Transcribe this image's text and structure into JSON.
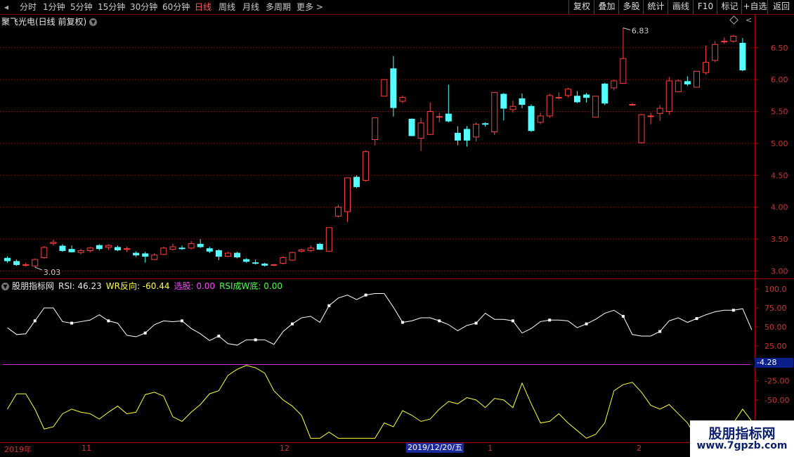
{
  "toolbar": {
    "periods": [
      "分时",
      "1分钟",
      "5分钟",
      "15分钟",
      "30分钟",
      "60分钟",
      "日线",
      "周线",
      "月线",
      "多周期",
      "更多"
    ],
    "active_period": "日线",
    "more_chevron": ">",
    "right_buttons": [
      "复权",
      "叠加",
      "多股",
      "统计",
      "画线",
      "F10",
      "标记",
      "+自选",
      "返回"
    ]
  },
  "main_chart": {
    "title": "聚飞光电(日线 前复权)",
    "dropdown_icon": "chevron-down-icon",
    "max_label": "6.83",
    "min_label": "3.03",
    "y_ticks": [
      "6.50",
      "6.00",
      "5.50",
      "5.00",
      "4.50",
      "4.00",
      "3.50",
      "3.00"
    ]
  },
  "indicator": {
    "name": "股朋指标网",
    "rsi": "RSI: 46.23",
    "wr": "WR反向: -60.44",
    "xuangu": "选股: 0.00",
    "rsiw": "RSI成W底: 0.00",
    "y_ticks": [
      "100.0",
      "75.00",
      "50.00",
      "25.00",
      "-25.00",
      "-50.00"
    ],
    "cursor_value": "-4.28"
  },
  "x_axis": {
    "labels": [
      "2019年",
      "11",
      "12",
      "1",
      "2"
    ],
    "highlight_date": "2019/12/20/五"
  },
  "watermark": {
    "line1": "股朋指标网",
    "line2": "www.7gpzb.com"
  },
  "colors": {
    "up": "#ff4040",
    "down": "#54ffff",
    "rsi": "#ffffff",
    "wr": "#ffff33",
    "zero_line": "#cc33cc"
  },
  "chart_data": {
    "type": "candlestick",
    "price_axis": {
      "min": 2.95,
      "max": 6.85
    },
    "candles": [
      [
        3.2,
        3.16,
        3.23,
        3.13
      ],
      [
        3.15,
        3.1,
        3.18,
        3.08
      ],
      [
        3.09,
        3.1,
        3.13,
        3.07
      ],
      [
        3.08,
        3.18,
        3.2,
        3.06
      ],
      [
        3.21,
        3.37,
        3.39,
        3.19
      ],
      [
        3.43,
        3.45,
        3.49,
        3.4
      ],
      [
        3.39,
        3.32,
        3.42,
        3.3
      ],
      [
        3.34,
        3.3,
        3.4,
        3.29
      ],
      [
        3.29,
        3.32,
        3.35,
        3.26
      ],
      [
        3.32,
        3.36,
        3.38,
        3.29
      ],
      [
        3.4,
        3.35,
        3.42,
        3.32
      ],
      [
        3.37,
        3.4,
        3.42,
        3.33
      ],
      [
        3.37,
        3.33,
        3.4,
        3.31
      ],
      [
        3.34,
        3.35,
        3.38,
        3.3
      ],
      [
        3.28,
        3.25,
        3.31,
        3.22
      ],
      [
        3.27,
        3.23,
        3.3,
        3.13
      ],
      [
        3.18,
        3.25,
        3.28,
        3.18
      ],
      [
        3.26,
        3.36,
        3.38,
        3.25
      ],
      [
        3.34,
        3.38,
        3.43,
        3.32
      ],
      [
        3.36,
        3.35,
        3.4,
        3.33
      ],
      [
        3.36,
        3.43,
        3.47,
        3.34
      ],
      [
        3.42,
        3.38,
        3.5,
        3.36
      ],
      [
        3.35,
        3.31,
        3.38,
        3.28
      ],
      [
        3.32,
        3.23,
        3.34,
        3.17
      ],
      [
        3.23,
        3.28,
        3.3,
        3.22
      ],
      [
        3.28,
        3.22,
        3.3,
        3.2
      ],
      [
        3.18,
        3.15,
        3.2,
        3.13
      ],
      [
        3.13,
        3.12,
        3.18,
        3.1
      ],
      [
        3.11,
        3.09,
        3.13,
        3.07
      ],
      [
        3.09,
        3.1,
        3.11,
        3.08
      ],
      [
        3.12,
        3.21,
        3.23,
        3.1
      ],
      [
        3.17,
        3.29,
        3.3,
        3.16
      ],
      [
        3.31,
        3.33,
        3.35,
        3.29
      ],
      [
        3.32,
        3.36,
        3.4,
        3.3
      ],
      [
        3.42,
        3.34,
        3.44,
        3.33
      ],
      [
        3.31,
        3.68,
        3.68,
        3.3
      ],
      [
        3.86,
        4.0,
        4.04,
        3.84
      ],
      [
        3.93,
        4.46,
        4.46,
        3.77
      ],
      [
        4.47,
        4.32,
        4.5,
        4.3
      ],
      [
        4.42,
        4.87,
        4.89,
        4.4
      ],
      [
        5.06,
        5.4,
        5.4,
        4.97
      ],
      [
        5.74,
        6.0,
        6.0,
        5.74
      ],
      [
        6.17,
        5.56,
        6.37,
        5.42
      ],
      [
        5.66,
        5.72,
        5.75,
        5.63
      ],
      [
        5.38,
        5.12,
        5.39,
        5.12
      ],
      [
        5.08,
        5.32,
        5.4,
        4.88
      ],
      [
        5.14,
        5.5,
        5.64,
        5.13
      ],
      [
        5.41,
        5.42,
        5.48,
        5.33
      ],
      [
        5.46,
        5.35,
        5.92,
        5.33
      ],
      [
        5.16,
        5.05,
        5.27,
        4.97
      ],
      [
        5.22,
        5.05,
        5.27,
        4.95
      ],
      [
        5.1,
        5.3,
        5.33,
        5.03
      ],
      [
        5.31,
        5.3,
        5.33,
        5.26
      ],
      [
        5.18,
        5.8,
        5.8,
        5.13
      ],
      [
        5.77,
        5.55,
        5.79,
        5.36
      ],
      [
        5.53,
        5.58,
        5.67,
        5.48
      ],
      [
        5.7,
        5.61,
        5.78,
        5.55
      ],
      [
        5.58,
        5.2,
        5.61,
        5.18
      ],
      [
        5.33,
        5.43,
        5.48,
        5.3
      ],
      [
        5.43,
        5.75,
        5.78,
        5.4
      ],
      [
        5.71,
        5.72,
        5.8,
        5.69
      ],
      [
        5.75,
        5.85,
        5.87,
        5.72
      ],
      [
        5.74,
        5.65,
        5.82,
        5.63
      ],
      [
        5.76,
        5.72,
        5.79,
        5.64
      ],
      [
        5.41,
        5.74,
        5.74,
        5.42
      ],
      [
        5.93,
        5.63,
        5.95,
        5.6
      ],
      [
        5.87,
        5.98,
        6.0,
        5.83
      ],
      [
        5.94,
        6.33,
        6.81,
        6.02
      ],
      [
        5.6,
        5.61,
        5.63,
        5.59
      ],
      [
        5.01,
        5.45,
        5.46,
        5.0
      ],
      [
        5.42,
        5.43,
        5.48,
        5.3
      ],
      [
        5.47,
        5.55,
        5.6,
        5.35
      ],
      [
        5.5,
        5.98,
        6.04,
        5.45
      ],
      [
        5.81,
        5.98,
        6.0,
        5.8
      ],
      [
        5.97,
        5.93,
        6.05,
        5.9
      ],
      [
        5.88,
        6.13,
        6.13,
        5.88
      ],
      [
        6.11,
        6.27,
        6.53,
        6.08
      ],
      [
        6.3,
        6.55,
        6.6,
        6.27
      ],
      [
        6.6,
        6.6,
        6.66,
        6.56
      ],
      [
        6.6,
        6.68,
        6.7,
        6.58
      ],
      [
        6.57,
        6.15,
        6.65,
        6.13
      ]
    ],
    "rsi": [
      49,
      40,
      41,
      58,
      75,
      75,
      57,
      55,
      57,
      59,
      66,
      58,
      55,
      39,
      37,
      42,
      53,
      58,
      57,
      58,
      48,
      41,
      32,
      38,
      28,
      26,
      33,
      33,
      33,
      27,
      44,
      54,
      62,
      64,
      56,
      78,
      88,
      92,
      86,
      92,
      94,
      94,
      76,
      56,
      58,
      62,
      62,
      58,
      53,
      45,
      52,
      55,
      68,
      60,
      60,
      58,
      42,
      48,
      57,
      59,
      59,
      58,
      49,
      54,
      60,
      68,
      72,
      64,
      40,
      38,
      38,
      44,
      58,
      62,
      56,
      61,
      66,
      70,
      72,
      72,
      74,
      46
    ],
    "wr": [
      -62,
      -42,
      -42,
      -62,
      -88,
      -85,
      -68,
      -62,
      -66,
      -68,
      -75,
      -66,
      -58,
      -68,
      -66,
      -43,
      -40,
      -45,
      -72,
      -78,
      -66,
      -56,
      -42,
      -38,
      -18,
      -10,
      -5,
      -8,
      -15,
      -38,
      -50,
      -58,
      -70,
      -100,
      -100,
      -92,
      -100,
      -100,
      -100,
      -100,
      -100,
      -80,
      -85,
      -64,
      -70,
      -78,
      -75,
      -62,
      -52,
      -55,
      -47,
      -50,
      -60,
      -48,
      -50,
      -60,
      -28,
      -55,
      -80,
      -78,
      -68,
      -80,
      -90,
      -100,
      -95,
      -80,
      -38,
      -30,
      -27,
      -40,
      -57,
      -62,
      -56,
      -68,
      -80,
      -100,
      -100,
      -100,
      -100,
      -80,
      -62,
      -78
    ]
  }
}
